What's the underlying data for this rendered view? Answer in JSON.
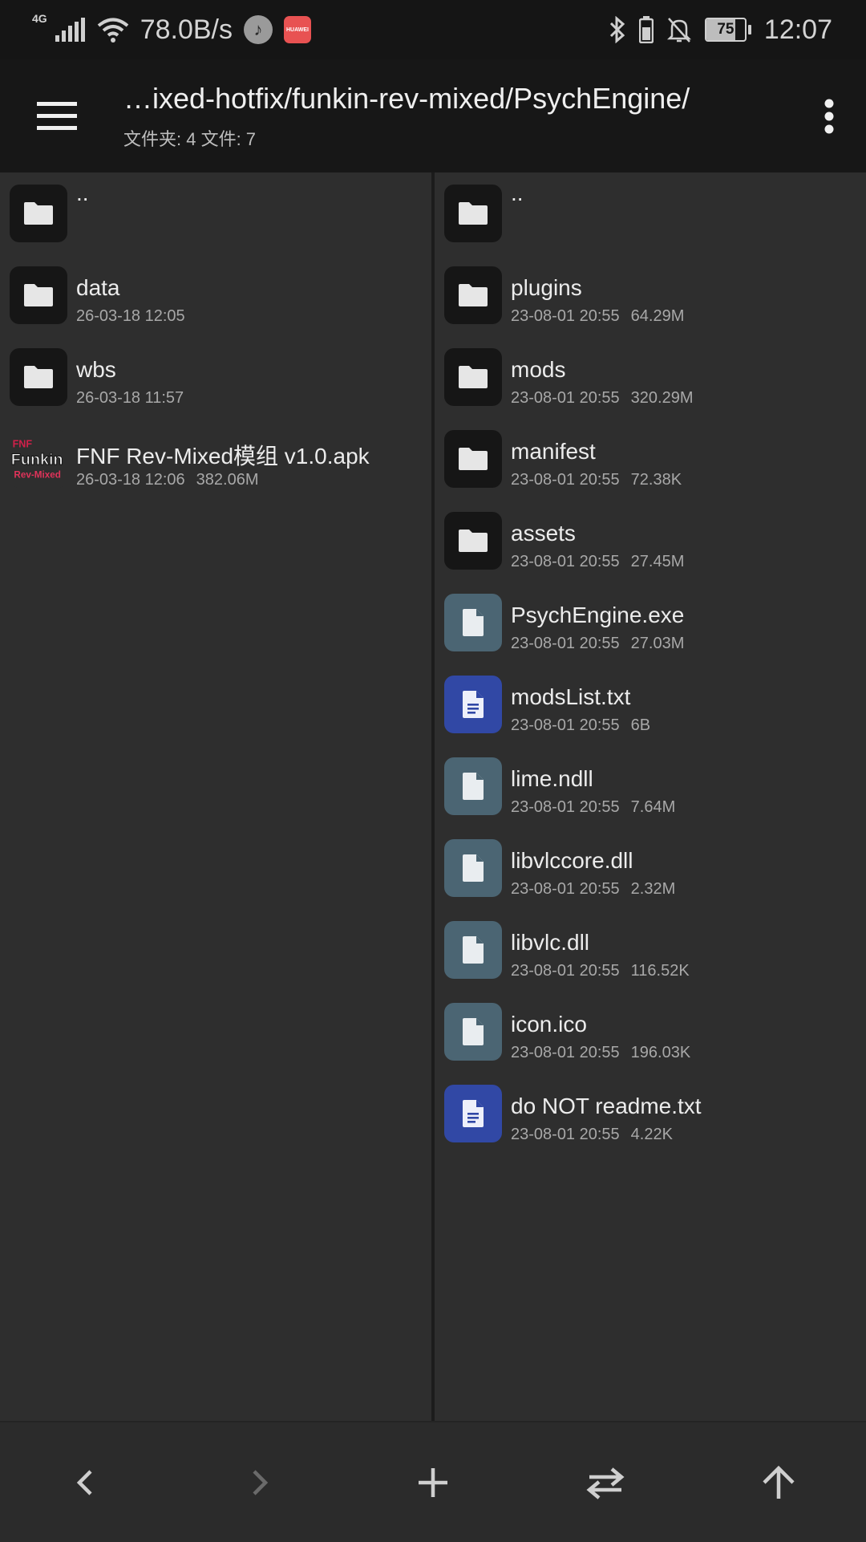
{
  "status_bar": {
    "network": "4G",
    "speed": "78.0B/s",
    "battery_level": "75",
    "battery_fraction": 0.75,
    "time": "12:07",
    "huawei_badge": "HUAWEI"
  },
  "app_bar": {
    "path": "…ixed-hotfix/funkin-rev-mixed/PsychEngine/",
    "summary": "文件夹: 4  文件: 7"
  },
  "left_pane": {
    "items": [
      {
        "name": "..",
        "date": "",
        "size": "",
        "kind": "folder"
      },
      {
        "name": "data",
        "date": "26-03-18 12:05",
        "size": "",
        "kind": "folder"
      },
      {
        "name": "wbs",
        "date": "26-03-18 11:57",
        "size": "",
        "kind": "folder"
      },
      {
        "name": "FNF Rev-Mixed模组 v1.0.apk",
        "date": "26-03-18 12:06",
        "size": "382.06M",
        "kind": "apk"
      }
    ],
    "apk_logo_top": "FNF",
    "apk_logo_main": "Funkin",
    "apk_logo_sub": "Rev-Mixed"
  },
  "right_pane": {
    "items": [
      {
        "name": "..",
        "date": "",
        "size": "",
        "kind": "folder"
      },
      {
        "name": "plugins",
        "date": "23-08-01 20:55",
        "size": "64.29M",
        "kind": "folder"
      },
      {
        "name": "mods",
        "date": "23-08-01 20:55",
        "size": "320.29M",
        "kind": "folder"
      },
      {
        "name": "manifest",
        "date": "23-08-01 20:55",
        "size": "72.38K",
        "kind": "folder"
      },
      {
        "name": "assets",
        "date": "23-08-01 20:55",
        "size": "27.45M",
        "kind": "folder"
      },
      {
        "name": "PsychEngine.exe",
        "date": "23-08-01 20:55",
        "size": "27.03M",
        "kind": "file"
      },
      {
        "name": "modsList.txt",
        "date": "23-08-01 20:55",
        "size": "6B",
        "kind": "txt"
      },
      {
        "name": "lime.ndll",
        "date": "23-08-01 20:55",
        "size": "7.64M",
        "kind": "file"
      },
      {
        "name": "libvlccore.dll",
        "date": "23-08-01 20:55",
        "size": "2.32M",
        "kind": "file"
      },
      {
        "name": "libvlc.dll",
        "date": "23-08-01 20:55",
        "size": "116.52K",
        "kind": "file"
      },
      {
        "name": "icon.ico",
        "date": "23-08-01 20:55",
        "size": "196.03K",
        "kind": "file"
      },
      {
        "name": "do NOT readme.txt",
        "date": "23-08-01 20:55",
        "size": "4.22K",
        "kind": "txt"
      }
    ]
  },
  "bottom_bar": {
    "buttons": [
      "back",
      "forward",
      "add",
      "swap-panes",
      "parent-directory"
    ]
  },
  "colors": {
    "background": "#2e2e2e",
    "toolbar": "#171717",
    "folder_tile": "#161616",
    "file_tile": "#4b6573",
    "text_tile": "#3148a5",
    "huawei_badge": "#e85252"
  }
}
